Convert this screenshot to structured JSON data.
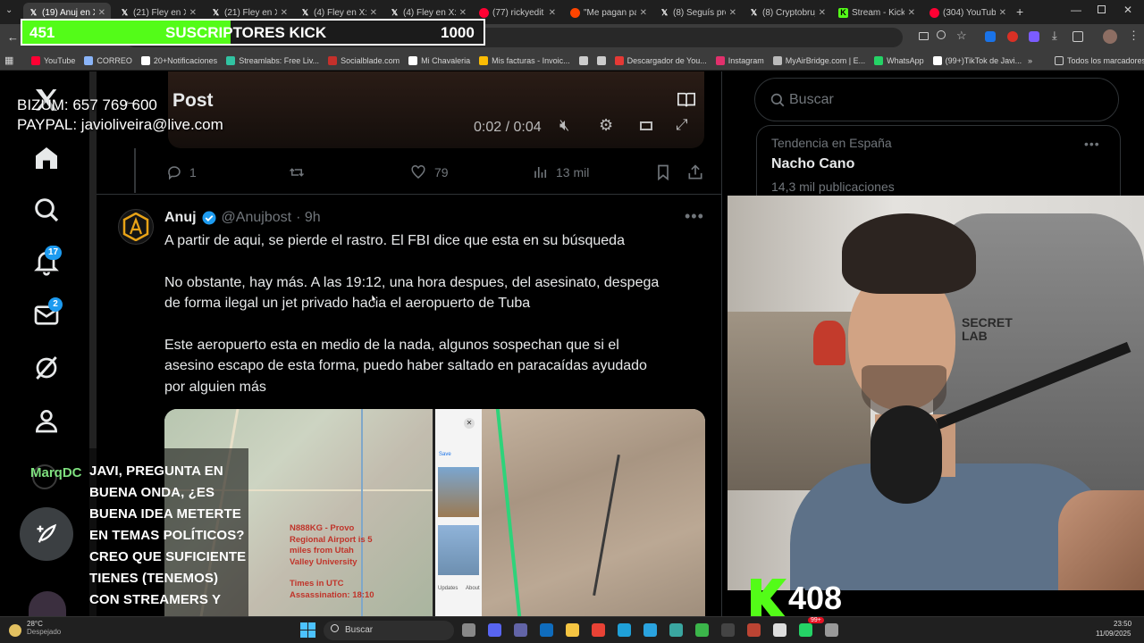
{
  "browser": {
    "tabs": [
      {
        "label": "(19) Anuj en X",
        "icon": "x-icon",
        "color": "#ffffff",
        "active": true
      },
      {
        "label": "(21) Fley en X:",
        "icon": "x-icon",
        "color": "#ffffff"
      },
      {
        "label": "(21) Fley en X:",
        "icon": "x-icon",
        "color": "#ffffff"
      },
      {
        "label": "(4) Fley en X: \"",
        "icon": "x-icon",
        "color": "#ffffff"
      },
      {
        "label": "(4) Fley en X: \"",
        "icon": "x-icon",
        "color": "#ffffff"
      },
      {
        "label": "(77) rickyedit",
        "icon": "youtube-icon",
        "color": "#ff0033"
      },
      {
        "label": "\"Me pagan pa",
        "icon": "reddit-icon",
        "color": "#ff4500"
      },
      {
        "label": "(8) Seguís preg",
        "icon": "x-icon",
        "color": "#ffffff"
      },
      {
        "label": "(8) Cryptobruj",
        "icon": "x-icon",
        "color": "#ffffff"
      },
      {
        "label": "Stream - Kick",
        "icon": "kick-icon",
        "color": "#53fc18"
      },
      {
        "label": "(304) YouTube",
        "icon": "youtube-icon",
        "color": "#ff0033"
      }
    ],
    "bookmarks": [
      {
        "label": "YouTube",
        "color": "#ff0033"
      },
      {
        "label": "CORREO",
        "color": "#8ab4f8"
      },
      {
        "label": "20+Notificaciones",
        "color": "#ffffff"
      },
      {
        "label": "Streamlabs: Free Liv...",
        "color": "#31c3a2"
      },
      {
        "label": "Socialblade.com",
        "color": "#c4302b"
      },
      {
        "label": "Mi Chavaleria",
        "color": "#ffffff"
      },
      {
        "label": "Mis facturas - Invoic...",
        "color": "#fbbc04"
      },
      {
        "label": "",
        "color": "#cccccc"
      },
      {
        "label": "",
        "color": "#cccccc"
      },
      {
        "label": "Descargador de You...",
        "color": "#e53935"
      },
      {
        "label": "Instagram",
        "color": "#e1306c"
      },
      {
        "label": "MyAirBridge.com | E...",
        "color": "#bbbbbb"
      },
      {
        "label": "WhatsApp",
        "color": "#25d366"
      },
      {
        "label": "(99+)TikTok de Javi...",
        "color": "#ffffff"
      }
    ],
    "all_bookmarks": "Todos los marcadores",
    "url_fragment": "10583971222025"
  },
  "kick_goal": {
    "current": "451",
    "label": "SUSCRIPTORES KICK",
    "target": "1000",
    "progress": 0.451,
    "color": "#53fc18"
  },
  "donations": {
    "bizum": "BIZUM: 657 769 600",
    "paypal": "PAYPAL: javioliveira@live.com"
  },
  "header": {
    "title": "Post"
  },
  "nav": {
    "notifications_badge": "17",
    "messages_badge": "2"
  },
  "video": {
    "time": "0:02 / 0:04"
  },
  "prev_tweet_actions": {
    "replies": "1",
    "likes": "79",
    "views": "13 mil"
  },
  "tweet": {
    "author": "Anuj",
    "handle": "@Anujbost",
    "time": "· 9h",
    "paragraph1": "A partir de aqui, se pierde el rastro. El FBI dice que esta en su búsqueda",
    "paragraph2_line1": "No obstante, hay más. A las 19:12, una hora despues, del asesinato, despega",
    "paragraph2_line2": "de forma ilegal un jet privado hacia el aeropuerto de Tuba",
    "paragraph3_line1": "Este aeropuerto esta en medio de la nada, algunos sospechan que si el",
    "paragraph3_line2": "asesino escapo de esta forma, puedo haber saltado en paracaídas ayudado",
    "paragraph3_line3": "por alguien más",
    "map_text1": "N888KG - Provo",
    "map_text2": "Regional Airport is 5",
    "map_text3": "miles from Utah",
    "map_text4": "Valley University",
    "map_text5": "Times in UTC",
    "map_text6": "Assassination: 18:10",
    "phone_save": "Save",
    "phone_updates": "Updates",
    "phone_about": "About"
  },
  "sidebar": {
    "search_placeholder": "Buscar",
    "trend_context": "Tendencia en España",
    "trend_name": "Nacho Cano",
    "trend_count": "14,3 mil publicaciones"
  },
  "webcam": {
    "chair_brand": "SECRET LAB"
  },
  "chat": {
    "username": "MarqDC",
    "message": "JAVI, PREGUNTA EN BUENA ONDA, ¿ES BUENA IDEA METERTE EN TEMAS POLÍTICOS? CREO QUE SUFICIENTE TIENES (TENEMOS) CON STREAMERS Y YOUTUBERS IDIOTAS"
  },
  "kick_counter": {
    "value": "408"
  },
  "taskbar": {
    "weather_temp": "28°C",
    "weather_desc": "Despejado",
    "search_label": "Buscar",
    "badge": "99+",
    "time": "23:50",
    "date": "11/09/2025"
  }
}
